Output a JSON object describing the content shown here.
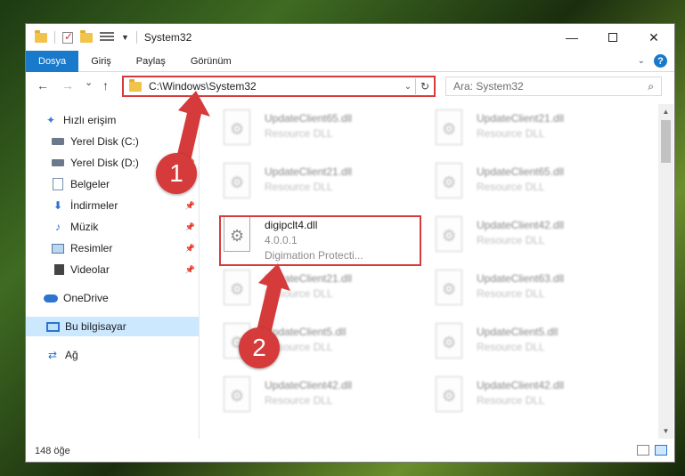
{
  "window": {
    "title": "System32",
    "controls": {
      "minimize": "—",
      "maximize": "",
      "close": "✕"
    }
  },
  "ribbon": {
    "tabs": [
      "Dosya",
      "Giriş",
      "Paylaş",
      "Görünüm"
    ],
    "help_label": "?"
  },
  "nav": {
    "back": "←",
    "forward": "→",
    "recent": "⌄",
    "up": "↑",
    "address": "C:\\Windows\\System32",
    "search_placeholder": "Ara: System32"
  },
  "sidebar": {
    "items": [
      {
        "label": "Hızlı erişim",
        "icon": "star-icon",
        "pinned": false
      },
      {
        "label": "Yerel Disk (C:)",
        "icon": "drive-icon",
        "pinned": true
      },
      {
        "label": "Yerel Disk (D:)",
        "icon": "drive-icon",
        "pinned": true
      },
      {
        "label": "Belgeler",
        "icon": "document-icon",
        "pinned": true
      },
      {
        "label": "İndirmeler",
        "icon": "download-icon",
        "pinned": true
      },
      {
        "label": "Müzik",
        "icon": "music-icon",
        "pinned": true
      },
      {
        "label": "Resimler",
        "icon": "pictures-icon",
        "pinned": true
      },
      {
        "label": "Videolar",
        "icon": "videos-icon",
        "pinned": true
      },
      {
        "label": "OneDrive",
        "icon": "cloud-icon",
        "pinned": false
      },
      {
        "label": "Bu bilgisayar",
        "icon": "computer-icon",
        "pinned": false,
        "selected": true
      },
      {
        "label": "Ağ",
        "icon": "network-icon",
        "pinned": false
      }
    ]
  },
  "files": [
    {
      "name": "UpdateClient65.dll",
      "desc": "Resource DLL"
    },
    {
      "name": "UpdateClient21.dll",
      "desc": "Resource DLL"
    },
    {
      "name": "UpdateClient21.dll",
      "desc": "Resource DLL"
    },
    {
      "name": "UpdateClient65.dll",
      "desc": "Resource DLL"
    },
    {
      "name": "digipclt4.dll",
      "desc": "4.0.0.1",
      "desc2": "Digimation Protecti...",
      "highlighted": true
    },
    {
      "name": "UpdateClient42.dll",
      "desc": "Resource DLL"
    },
    {
      "name": "UpdateClient21.dll",
      "desc": "Resource DLL"
    },
    {
      "name": "UpdateClient63.dll",
      "desc": "Resource DLL"
    },
    {
      "name": "UpdateClient5.dll",
      "desc": "Resource DLL"
    },
    {
      "name": "UpdateClient5.dll",
      "desc": "Resource DLL"
    },
    {
      "name": "UpdateClient42.dll",
      "desc": "Resource DLL"
    },
    {
      "name": "UpdateClient42.dll",
      "desc": "Resource DLL"
    }
  ],
  "status": {
    "count": "148 öğe"
  },
  "callouts": {
    "step1": "1",
    "step2": "2"
  },
  "colors": {
    "accent": "#1979ca",
    "highlight": "#d63b3b",
    "selected": "#cce8ff"
  }
}
